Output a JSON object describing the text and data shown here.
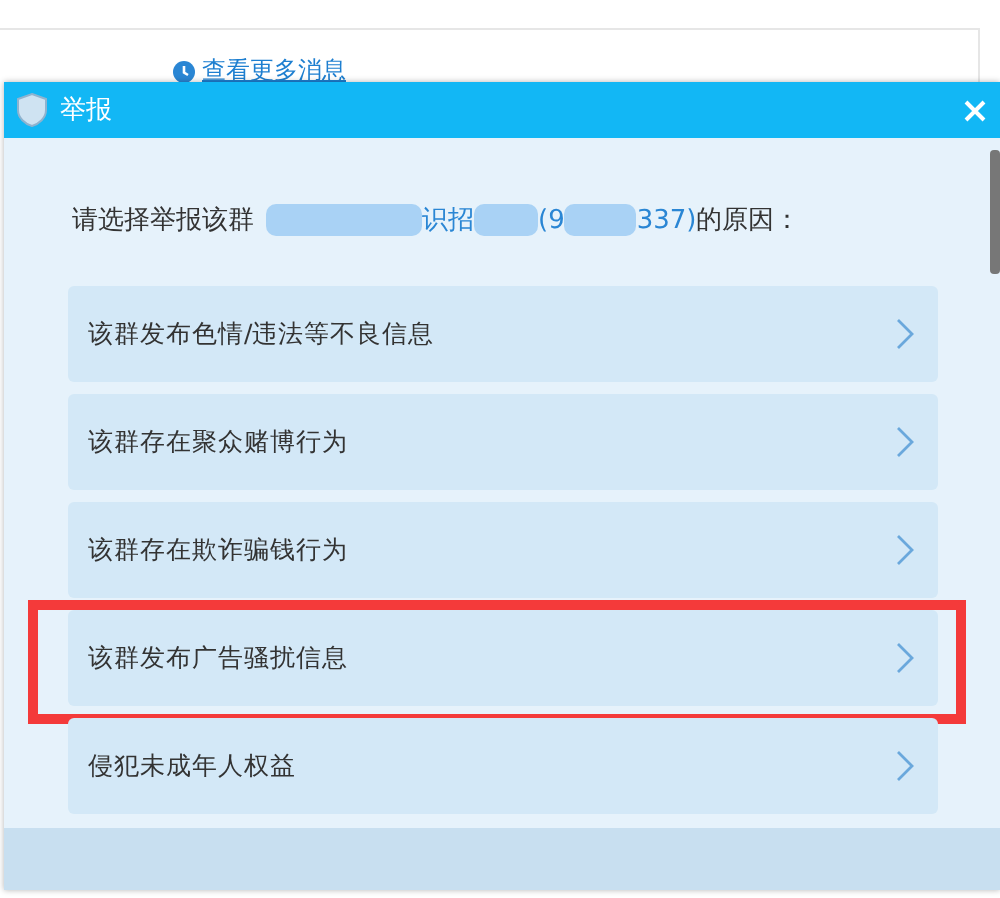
{
  "background": {
    "link": "查看更多消息"
  },
  "dialog": {
    "title": "举报",
    "prompt": {
      "before": "请选择举报该群",
      "parts": [
        "识招",
        "(9",
        "337)"
      ],
      "after": " 的原因："
    },
    "reasons": [
      {
        "label": "该群发布色情/违法等不良信息",
        "highlighted": false
      },
      {
        "label": "该群存在聚众赌博行为",
        "highlighted": false
      },
      {
        "label": "该群存在欺诈骗钱行为",
        "highlighted": false
      },
      {
        "label": "该群发布广告骚扰信息",
        "highlighted": true
      },
      {
        "label": "侵犯未成年人权益",
        "highlighted": false
      }
    ]
  }
}
